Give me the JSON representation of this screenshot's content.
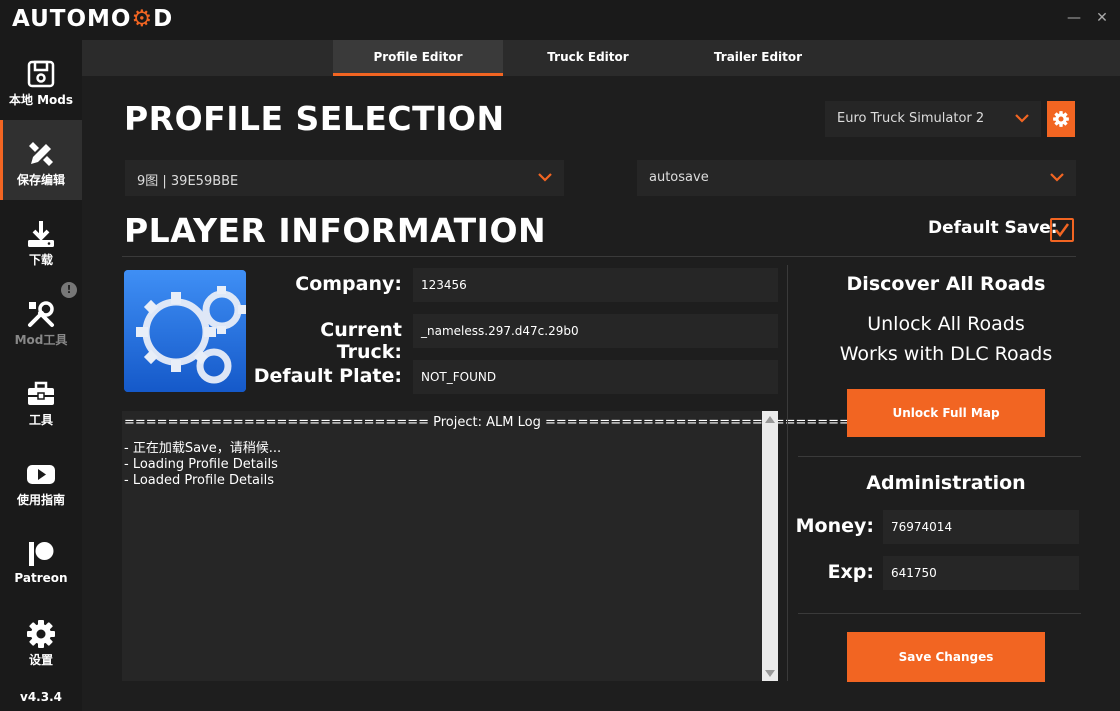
{
  "app": {
    "logo_left": "AUTOMO",
    "logo_right": "D",
    "version": "v4.3.4"
  },
  "window": {
    "minimize": "—",
    "close": "✕"
  },
  "sidebar": {
    "items": [
      {
        "label": "本地 Mods",
        "icon": "save-icon"
      },
      {
        "label": "保存编辑",
        "icon": "edit-tools-icon"
      },
      {
        "label": "下载",
        "icon": "download-icon"
      },
      {
        "label": "Mod工具",
        "icon": "wrench-icon",
        "badge": "!"
      },
      {
        "label": "工具",
        "icon": "toolbox-icon"
      },
      {
        "label": "使用指南",
        "icon": "youtube-icon"
      },
      {
        "label": "Patreon",
        "icon": "patreon-icon"
      },
      {
        "label": "设置",
        "icon": "gear-icon"
      }
    ]
  },
  "tabs": [
    {
      "label": "Profile Editor"
    },
    {
      "label": "Truck Editor"
    },
    {
      "label": "Trailer Editor"
    }
  ],
  "profile_selection": {
    "heading": "PROFILE SELECTION",
    "game": "Euro Truck Simulator 2",
    "profile": "9图 | 39E59BBE",
    "save": "autosave"
  },
  "player_information": {
    "heading": "PLAYER INFORMATION",
    "default_save_label": "Default Save:",
    "default_save_checked": true,
    "company_label": "Company:",
    "company_value": "123456",
    "truck_label": "Current Truck:",
    "truck_value": "_nameless.297.d47c.29b0",
    "plate_label": "Default Plate:",
    "plate_value": "NOT_FOUND"
  },
  "log": {
    "header": "============================ Project: ALM Log ============================",
    "lines": [
      "- 正在加载Save，请稍候...",
      "- Loading Profile Details",
      "- Loaded Profile Details"
    ]
  },
  "roads": {
    "title": "Discover All Roads",
    "line1": "Unlock All Roads",
    "line2": "Works with DLC Roads",
    "button": "Unlock Full Map"
  },
  "administration": {
    "title": "Administration",
    "money_label": "Money:",
    "money_value": "76974014",
    "exp_label": "Exp:",
    "exp_value": "641750",
    "save_button": "Save Changes"
  },
  "colors": {
    "accent": "#f26522",
    "background": "#1e1e1e",
    "panel": "#262626"
  }
}
